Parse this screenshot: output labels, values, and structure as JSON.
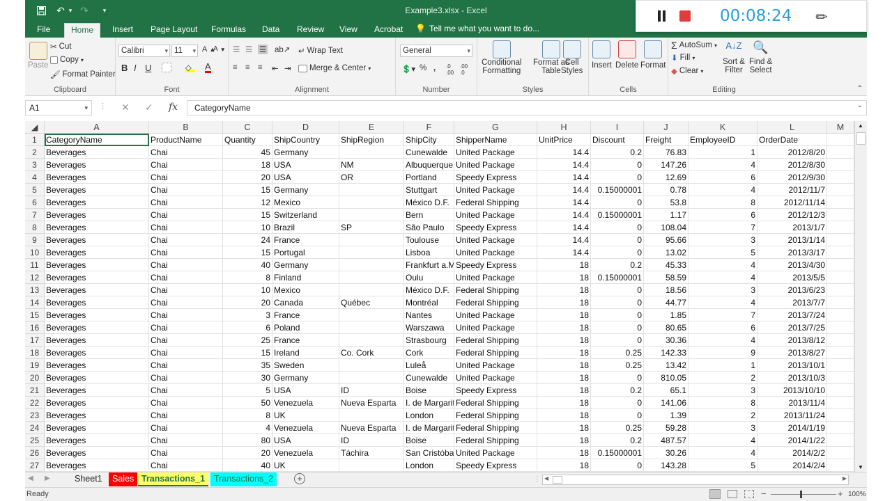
{
  "window": {
    "title": "Example3.xlsx - Excel"
  },
  "recorder": {
    "time": "00:08:24"
  },
  "tabs": [
    "File",
    "Home",
    "Insert",
    "Page Layout",
    "Formulas",
    "Data",
    "Review",
    "View",
    "Acrobat"
  ],
  "tell_me": "Tell me what you want to do...",
  "ribbon": {
    "clipboard": {
      "paste": "Paste",
      "cut": "Cut",
      "copy": "Copy",
      "format_painter": "Format Painter",
      "label": "Clipboard"
    },
    "font": {
      "name": "Calibri",
      "size": "11",
      "label": "Font"
    },
    "alignment": {
      "wrap": "Wrap Text",
      "merge": "Merge & Center",
      "label": "Alignment"
    },
    "number": {
      "format": "General",
      "label": "Number"
    },
    "styles": {
      "conditional": "Conditional",
      "conditional2": "Formatting",
      "format_table": "Format as",
      "format_table2": "Table",
      "cell_styles": "Cell",
      "cell_styles2": "Styles",
      "label": "Styles"
    },
    "cells": {
      "insert": "Insert",
      "delete": "Delete",
      "format": "Format",
      "label": "Cells"
    },
    "editing": {
      "autosum": "AutoSum",
      "fill": "Fill",
      "clear": "Clear",
      "sort": "Sort &",
      "sort2": "Filter",
      "find": "Find &",
      "find2": "Select",
      "label": "Editing"
    }
  },
  "formula_bar": {
    "name_box": "A1",
    "formula": "CategoryName"
  },
  "columns": [
    "A",
    "B",
    "C",
    "D",
    "E",
    "F",
    "G",
    "H",
    "I",
    "J",
    "K",
    "L",
    "M"
  ],
  "rows": [
    [
      "CategoryName",
      "ProductName",
      "Quantity",
      "ShipCountry",
      "ShipRegion",
      "ShipCity",
      "ShipperName",
      "UnitPrice",
      "Discount",
      "Freight",
      "EmployeeID",
      "OrderDate"
    ],
    [
      "Beverages",
      "Chai",
      "45",
      "Germany",
      "",
      "Cunewalde",
      "United Package",
      "14.4",
      "0.2",
      "76.83",
      "1",
      "2012/8/20"
    ],
    [
      "Beverages",
      "Chai",
      "18",
      "USA",
      "NM",
      "Albuquerque",
      "United Package",
      "14.4",
      "0",
      "147.26",
      "4",
      "2012/8/30"
    ],
    [
      "Beverages",
      "Chai",
      "20",
      "USA",
      "OR",
      "Portland",
      "Speedy Express",
      "14.4",
      "0",
      "12.69",
      "6",
      "2012/9/30"
    ],
    [
      "Beverages",
      "Chai",
      "15",
      "Germany",
      "",
      "Stuttgart",
      "United Package",
      "14.4",
      "0.15000001",
      "0.78",
      "4",
      "2012/11/7"
    ],
    [
      "Beverages",
      "Chai",
      "12",
      "Mexico",
      "",
      "México D.F.",
      "Federal Shipping",
      "14.4",
      "0",
      "53.8",
      "8",
      "2012/11/14"
    ],
    [
      "Beverages",
      "Chai",
      "15",
      "Switzerland",
      "",
      "Bern",
      "United Package",
      "14.4",
      "0.15000001",
      "1.17",
      "6",
      "2012/12/3"
    ],
    [
      "Beverages",
      "Chai",
      "10",
      "Brazil",
      "SP",
      "São Paulo",
      "Speedy Express",
      "14.4",
      "0",
      "108.04",
      "7",
      "2013/1/7"
    ],
    [
      "Beverages",
      "Chai",
      "24",
      "France",
      "",
      "Toulouse",
      "United Package",
      "14.4",
      "0",
      "95.66",
      "3",
      "2013/1/14"
    ],
    [
      "Beverages",
      "Chai",
      "15",
      "Portugal",
      "",
      "Lisboa",
      "United Package",
      "14.4",
      "0",
      "13.02",
      "5",
      "2013/3/17"
    ],
    [
      "Beverages",
      "Chai",
      "40",
      "Germany",
      "",
      "Frankfurt a.M.",
      "Speedy Express",
      "18",
      "0.2",
      "45.33",
      "4",
      "2013/4/30"
    ],
    [
      "Beverages",
      "Chai",
      "8",
      "Finland",
      "",
      "Oulu",
      "United Package",
      "18",
      "0.15000001",
      "58.59",
      "4",
      "2013/5/5"
    ],
    [
      "Beverages",
      "Chai",
      "10",
      "Mexico",
      "",
      "México D.F.",
      "Federal Shipping",
      "18",
      "0",
      "18.56",
      "3",
      "2013/6/23"
    ],
    [
      "Beverages",
      "Chai",
      "20",
      "Canada",
      "Québec",
      "Montréal",
      "Federal Shipping",
      "18",
      "0",
      "44.77",
      "4",
      "2013/7/7"
    ],
    [
      "Beverages",
      "Chai",
      "3",
      "France",
      "",
      "Nantes",
      "United Package",
      "18",
      "0",
      "1.85",
      "7",
      "2013/7/24"
    ],
    [
      "Beverages",
      "Chai",
      "6",
      "Poland",
      "",
      "Warszawa",
      "United Package",
      "18",
      "0",
      "80.65",
      "6",
      "2013/7/25"
    ],
    [
      "Beverages",
      "Chai",
      "25",
      "France",
      "",
      "Strasbourg",
      "Federal Shipping",
      "18",
      "0",
      "30.36",
      "4",
      "2013/8/12"
    ],
    [
      "Beverages",
      "Chai",
      "15",
      "Ireland",
      "Co. Cork",
      "Cork",
      "Federal Shipping",
      "18",
      "0.25",
      "142.33",
      "9",
      "2013/8/27"
    ],
    [
      "Beverages",
      "Chai",
      "35",
      "Sweden",
      "",
      "Luleå",
      "United Package",
      "18",
      "0.25",
      "13.42",
      "1",
      "2013/10/1"
    ],
    [
      "Beverages",
      "Chai",
      "30",
      "Germany",
      "",
      "Cunewalde",
      "United Package",
      "18",
      "0",
      "810.05",
      "2",
      "2013/10/3"
    ],
    [
      "Beverages",
      "Chai",
      "5",
      "USA",
      "ID",
      "Boise",
      "Speedy Express",
      "18",
      "0.2",
      "65.1",
      "3",
      "2013/10/10"
    ],
    [
      "Beverages",
      "Chai",
      "50",
      "Venezuela",
      "Nueva Esparta",
      "I. de Margarita",
      "Federal Shipping",
      "18",
      "0",
      "141.06",
      "8",
      "2013/11/4"
    ],
    [
      "Beverages",
      "Chai",
      "8",
      "UK",
      "",
      "London",
      "Federal Shipping",
      "18",
      "0",
      "1.39",
      "2",
      "2013/11/24"
    ],
    [
      "Beverages",
      "Chai",
      "4",
      "Venezuela",
      "Nueva Esparta",
      "I. de Margarita",
      "Federal Shipping",
      "18",
      "0.25",
      "59.28",
      "3",
      "2014/1/19"
    ],
    [
      "Beverages",
      "Chai",
      "80",
      "USA",
      "ID",
      "Boise",
      "Federal Shipping",
      "18",
      "0.2",
      "487.57",
      "4",
      "2014/1/22"
    ],
    [
      "Beverages",
      "Chai",
      "20",
      "Venezuela",
      "Táchira",
      "San Cristóbal",
      "United Package",
      "18",
      "0.15000001",
      "30.26",
      "4",
      "2014/2/2"
    ],
    [
      "Beverages",
      "Chai",
      "40",
      "UK",
      "",
      "London",
      "Speedy Express",
      "18",
      "0",
      "143.28",
      "5",
      "2014/2/4"
    ]
  ],
  "sheets": [
    {
      "name": "Sheet1",
      "bg": "#f0f0f0",
      "color": "#222"
    },
    {
      "name": "Sales",
      "bg": "#ff0000",
      "color": "#ffffff"
    },
    {
      "name": "Transactions_1",
      "bg": "#ffff66",
      "color": "#217346"
    },
    {
      "name": "Transactions_2",
      "bg": "#00ffff",
      "color": "#217346"
    }
  ],
  "status": {
    "ready": "Ready",
    "zoom": "100%"
  }
}
